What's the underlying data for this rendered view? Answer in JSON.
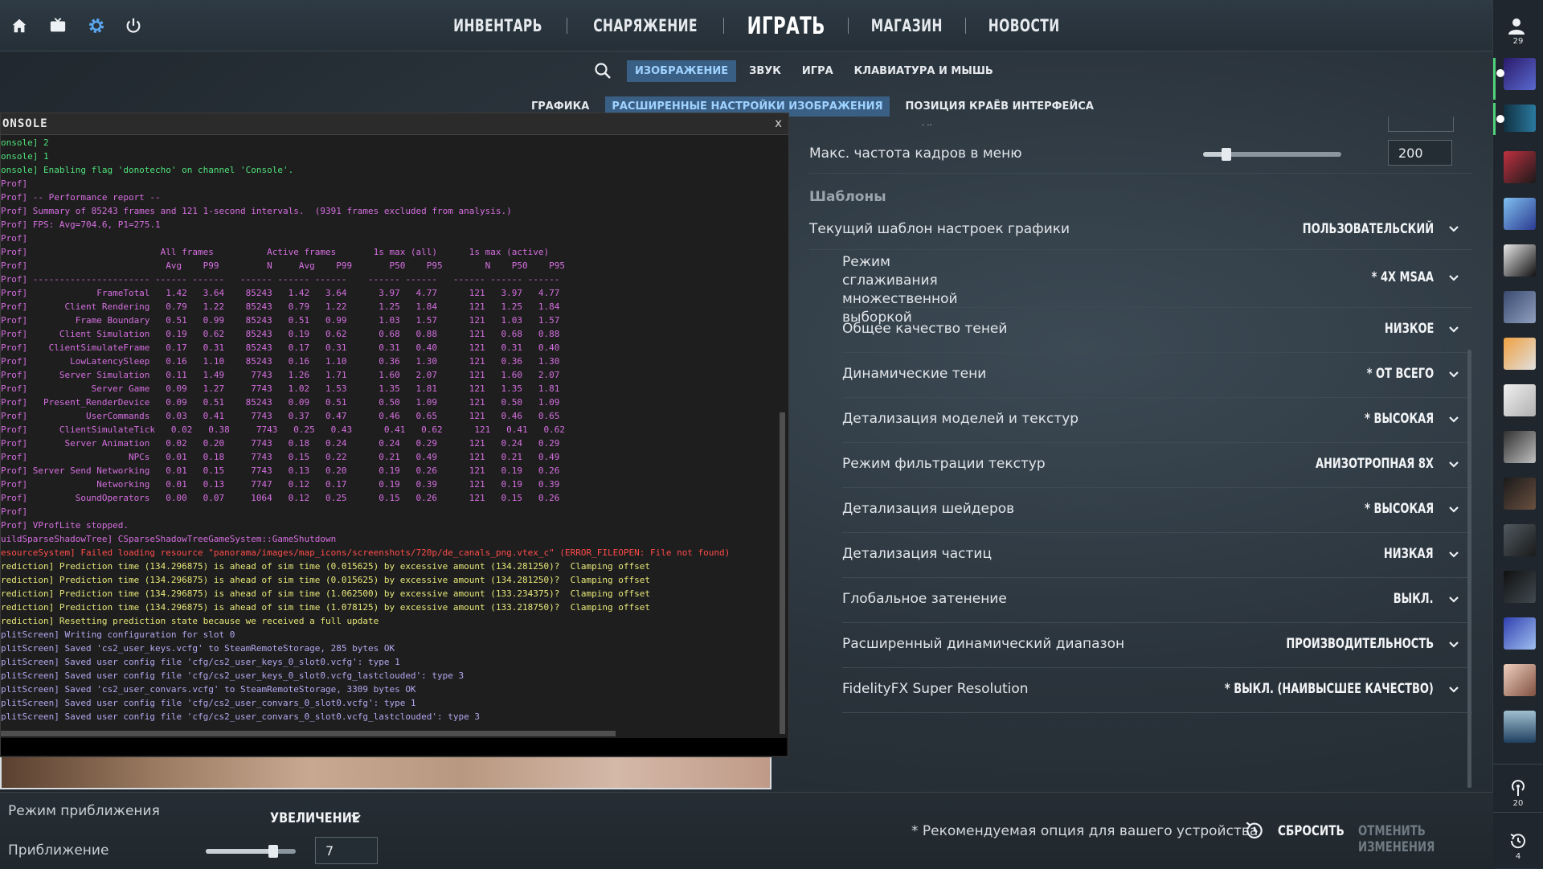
{
  "topbar": {
    "icons": [
      "home-icon",
      "tv-icon",
      "gear-icon",
      "power-icon"
    ],
    "nav": [
      "ИНВЕНТАРЬ",
      "СНАРЯЖЕНИЕ",
      "ИГРАТЬ",
      "МАГАЗИН",
      "НОВОСТИ"
    ],
    "player_count": "29"
  },
  "settings": {
    "tabs": [
      "ИЗОБРАЖЕНИЕ",
      "ЗВУК",
      "ИГРА",
      "КЛАВИАТУРА И МЫШЬ"
    ],
    "active_tab": "ИЗОБРАЖЕНИЕ",
    "subtabs": [
      "ГРАФИКА",
      "РАСШИРЕННЫЕ НАСТРОЙКИ ИЗОБРАЖЕНИЯ",
      "ПОЗИЦИЯ КРАЁВ ИНТЕРФЕЙСА"
    ],
    "active_subtab": "РАСШИРЕННЫЕ НАСТРОЙКИ ИЗОБРАЖЕНИЯ",
    "menu_fps": {
      "label": "Макс. частота кадров в меню",
      "value": "200",
      "slider_fraction": 0.17
    },
    "section_title": "Шаблоны",
    "preset": {
      "label": "Текущий шаблон настроек графики",
      "value": "ПОЛЬЗОВАТЕЛЬСКИЙ"
    },
    "options": [
      {
        "label": "Режим сглаживания множественной выборкой",
        "value": "* 4X MSAA"
      },
      {
        "label": "Общее качество теней",
        "value": "НИЗКОЕ"
      },
      {
        "label": "Динамические тени",
        "value": "* ОТ ВСЕГО"
      },
      {
        "label": "Детализация моделей и текстур",
        "value": "* ВЫСОКАЯ"
      },
      {
        "label": "Режим фильтрации текстур",
        "value": "АНИЗОТРОПНАЯ 8X"
      },
      {
        "label": "Детализация шейдеров",
        "value": "* ВЫСОКАЯ"
      },
      {
        "label": "Детализация частиц",
        "value": "НИЗКАЯ"
      },
      {
        "label": "Глобальное затенение",
        "value": "ВЫКЛ."
      },
      {
        "label": "Расширенный динамический диапазон",
        "value": "ПРОИЗВОДИТЕЛЬНОСТЬ"
      },
      {
        "label": "FidelityFX Super Resolution",
        "value": "* ВЫКЛ. (НАИВЫСШЕЕ КАЧЕСТВО)"
      }
    ]
  },
  "bottom": {
    "zoom_mode_label": "Режим приближения",
    "zoom_mode_value": "УВЕЛИЧЕНИЕ",
    "zoom_label": "Приближение",
    "zoom_value": "7",
    "zoom_slider_fraction": 0.75,
    "recommend_note": "* Рекомендуемая опция для вашего устройства",
    "reset_label": "СБРОСИТЬ",
    "cancel_label": "ОТМЕНИТЬ ИЗМЕНЕНИЯ"
  },
  "rightrail": {
    "listen_count": "20",
    "history_count": "4"
  },
  "console": {
    "title": "ONSOLE",
    "close": "x",
    "lines": [
      {
        "c": "green",
        "t": "onsole] 2"
      },
      {
        "c": "green",
        "t": "onsole] 1"
      },
      {
        "c": "green",
        "t": "onsole] Enabling flag 'donotecho' on channel 'Console'."
      },
      {
        "c": "prof",
        "t": "Prof]"
      },
      {
        "c": "prof",
        "t": "Prof] -- Performance report --"
      },
      {
        "c": "prof",
        "t": "Prof] Summary of 85243 frames and 121 1-second intervals.  (9391 frames excluded from analysis.)"
      },
      {
        "c": "prof",
        "t": "Prof] FPS: Avg=704.6, P1=275.1"
      },
      {
        "c": "prof",
        "t": "Prof]"
      },
      {
        "c": "prof",
        "t": "Prof]                         All frames          Active frames       1s max (all)      1s max (active)"
      },
      {
        "c": "prof",
        "t": "Prof]                          Avg    P99         N     Avg    P99       P50    P95        N    P50    P95"
      },
      {
        "c": "prof",
        "t": "Prof] ---------------------- ------ ------   ------ ------ ------    ------ ------   ------ ------ ------"
      },
      {
        "c": "prof",
        "t": "Prof]             FrameTotal   1.42   3.64    85243   1.42   3.64      3.97   4.77      121   3.97   4.77"
      },
      {
        "c": "prof",
        "t": "Prof]       Client Rendering   0.79   1.22    85243   0.79   1.22      1.25   1.84      121   1.25   1.84"
      },
      {
        "c": "prof",
        "t": "Prof]         Frame Boundary   0.51   0.99    85243   0.51   0.99      1.03   1.57      121   1.03   1.57"
      },
      {
        "c": "prof",
        "t": "Prof]      Client Simulation   0.19   0.62    85243   0.19   0.62      0.68   0.88      121   0.68   0.88"
      },
      {
        "c": "prof",
        "t": "Prof]    ClientSimulateFrame   0.17   0.31    85243   0.17   0.31      0.31   0.40      121   0.31   0.40"
      },
      {
        "c": "prof",
        "t": "Prof]        LowLatencySleep   0.16   1.10    85243   0.16   1.10      0.36   1.30      121   0.36   1.30"
      },
      {
        "c": "prof",
        "t": "Prof]      Server Simulation   0.11   1.49     7743   1.26   1.71      1.60   2.07      121   1.60   2.07"
      },
      {
        "c": "prof",
        "t": "Prof]            Server Game   0.09   1.27     7743   1.02   1.53      1.35   1.81      121   1.35   1.81"
      },
      {
        "c": "prof",
        "t": "Prof]   Present_RenderDevice   0.09   0.51    85243   0.09   0.51      0.50   1.09      121   0.50   1.09"
      },
      {
        "c": "prof",
        "t": "Prof]           UserCommands   0.03   0.41     7743   0.37   0.47      0.46   0.65      121   0.46   0.65"
      },
      {
        "c": "prof",
        "t": "Prof]      ClientSimulateTick   0.02   0.38     7743   0.25   0.43      0.41   0.62      121   0.41   0.62"
      },
      {
        "c": "prof",
        "t": "Prof]       Server Animation   0.02   0.20     7743   0.18   0.24      0.24   0.29      121   0.24   0.29"
      },
      {
        "c": "prof",
        "t": "Prof]                   NPCs   0.01   0.18     7743   0.15   0.22      0.21   0.49      121   0.21   0.49"
      },
      {
        "c": "prof",
        "t": "Prof] Server Send Networking   0.01   0.15     7743   0.13   0.20      0.19   0.26      121   0.19   0.26"
      },
      {
        "c": "prof",
        "t": "Prof]             Networking   0.01   0.13     7747   0.12   0.17      0.19   0.39      121   0.19   0.39"
      },
      {
        "c": "prof",
        "t": "Prof]         SoundOperators   0.00   0.07     1064   0.12   0.25      0.15   0.26      121   0.15   0.26"
      },
      {
        "c": "prof",
        "t": "Prof]"
      },
      {
        "c": "prof",
        "t": "Prof] VProfLite stopped."
      },
      {
        "c": "prof",
        "t": "uildSparseShadowTree] CSparseShadowTreeGameSystem::GameShutdown"
      },
      {
        "c": "red",
        "t": "esourceSystem] Failed loading resource \"panorama/images/map_icons/screenshots/720p/de_canals_png.vtex_c\" (ERROR_FILEOPEN: File not found)"
      },
      {
        "c": "yellow",
        "t": "rediction] Prediction time (134.296875) is ahead of sim time (0.015625) by excessive amount (134.281250)?  Clamping offset"
      },
      {
        "c": "yellow",
        "t": "rediction] Prediction time (134.296875) is ahead of sim time (0.015625) by excessive amount (134.281250)?  Clamping offset"
      },
      {
        "c": "yellow",
        "t": "rediction] Prediction time (134.296875) is ahead of sim time (1.062500) by excessive amount (133.234375)?  Clamping offset"
      },
      {
        "c": "yellow",
        "t": "rediction] Prediction time (134.296875) is ahead of sim time (1.078125) by excessive amount (133.218750)?  Clamping offset"
      },
      {
        "c": "yellow",
        "t": "rediction] Resetting prediction state because we received a full update"
      },
      {
        "c": "lav",
        "t": "plitScreen] Writing configuration for slot 0"
      },
      {
        "c": "lav",
        "t": "plitScreen] Saved 'cs2_user_keys.vcfg' to SteamRemoteStorage, 285 bytes OK"
      },
      {
        "c": "lav",
        "t": "plitScreen] Saved user config file 'cfg/cs2_user_keys_0_slot0.vcfg': type 1"
      },
      {
        "c": "lav",
        "t": "plitScreen] Saved user config file 'cfg/cs2_user_keys_0_slot0.vcfg_lastclouded': type 3"
      },
      {
        "c": "lav",
        "t": "plitScreen] Saved 'cs2_user_convars.vcfg' to SteamRemoteStorage, 3309 bytes OK"
      },
      {
        "c": "lav",
        "t": "plitScreen] Saved user config file 'cfg/cs2_user_convars_0_slot0.vcfg': type 1"
      },
      {
        "c": "lav",
        "t": "plitScreen] Saved user config file 'cfg/cs2_user_convars_0_slot0.vcfg_lastclouded': type 3"
      }
    ]
  },
  "colors": {
    "accent_tab_bg": "#3a5f85",
    "accent_tab_text": "#9fd2ff",
    "console_green": "#4fe07a",
    "console_prof": "#d56fe0",
    "console_error": "#ff4b4b",
    "console_warning": "#e8e87a",
    "console_splitscreen": "#b6a7f0"
  }
}
